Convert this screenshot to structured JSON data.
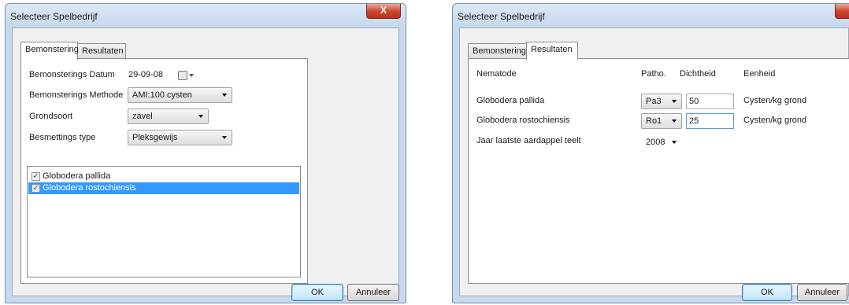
{
  "left_dialog": {
    "title": "Selecteer Spelbedrijf",
    "close_label": "X",
    "tabs": [
      {
        "label": "Bemonstering",
        "active": true
      },
      {
        "label": "Resultaten",
        "active": false
      }
    ],
    "fields": {
      "datum_label": "Bemonsterings Datum",
      "datum_value": "29-09-08",
      "methode_label": "Bemonsterings Methode",
      "methode_value": "AMI:100 cysten",
      "grondsoort_label": "Grondsoort",
      "grondsoort_value": "zavel",
      "besmetting_label": "Besmettings type",
      "besmetting_value": "Pleksgewijs"
    },
    "list_items": [
      {
        "label": "Globodera pallida",
        "checked": true,
        "selected": false
      },
      {
        "label": "Globodera rostochiensis",
        "checked": true,
        "selected": true
      }
    ],
    "ok_label": "OK",
    "cancel_label": "Annuleer"
  },
  "right_dialog": {
    "title": "Selecteer Spelbedrijf",
    "close_label": "X",
    "tabs": [
      {
        "label": "Bemonstering",
        "active": false
      },
      {
        "label": "Resultaten",
        "active": true
      }
    ],
    "headers": {
      "nematode": "Nematode",
      "patho": "Patho.",
      "dichtheid": "Dichtheid",
      "eenheid": "Eenheid"
    },
    "rows": [
      {
        "nematode": "Globodera pallida",
        "patho": "Pa3",
        "dichtheid": "50",
        "eenheid": "Cysten/kg grond"
      },
      {
        "nematode": "Globodera rostochiensis",
        "patho": "Ro1",
        "dichtheid": "25",
        "eenheid": "Cysten/kg grond"
      }
    ],
    "teelt_label": "Jaar laatste aardappel teelt",
    "teelt_value": "2008",
    "ok_label": "OK",
    "cancel_label": "Annuleer"
  }
}
